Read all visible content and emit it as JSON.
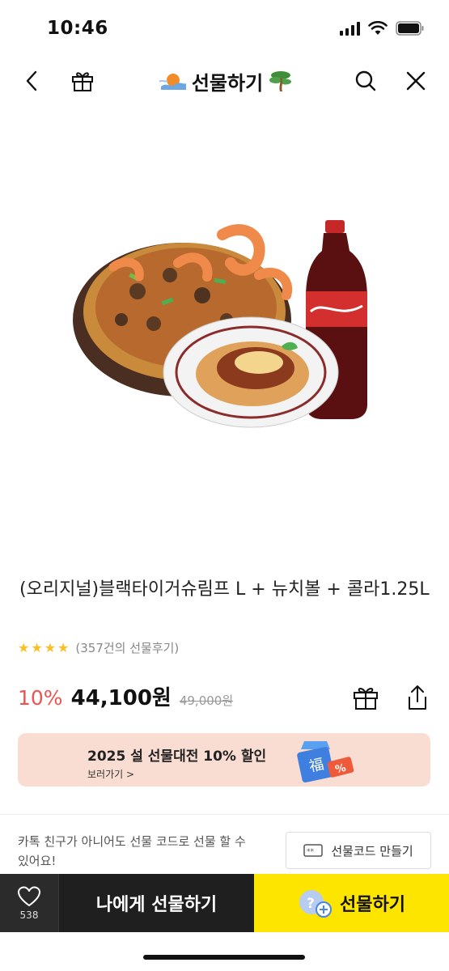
{
  "status_bar": {
    "time": "10:46"
  },
  "header": {
    "title": "선물하기",
    "back_icon": "chevron-left-icon",
    "gift_icon": "gift-icon",
    "search_icon": "search-icon",
    "close_icon": "close-icon"
  },
  "product": {
    "title": "(오리지널)블랙타이거슈림프 L + 뉴치볼 + 콜라1.25L",
    "rating_stars": 4,
    "review_count": "(357건의 선물후기)",
    "discount": "10%",
    "price": "44,100원",
    "original_price": "49,000원"
  },
  "promo": {
    "title": "2025 설 선물대전 10% 할인",
    "link": "보러가기 >"
  },
  "gift_code": {
    "description": "카톡 친구가 아니어도 선물 코드로 선물 할 수 있어요!",
    "button_label": "선물코드 만들기"
  },
  "bottom_bar": {
    "like_count": "538",
    "self_gift_label": "나에게 선물하기",
    "gift_label": "선물하기"
  },
  "colors": {
    "discount": "#ef5350",
    "star": "#fbbf24",
    "gift_button": "#fee500",
    "self_gift_button": "#1f1f1f",
    "promo_bg": "#f9ddd3"
  }
}
